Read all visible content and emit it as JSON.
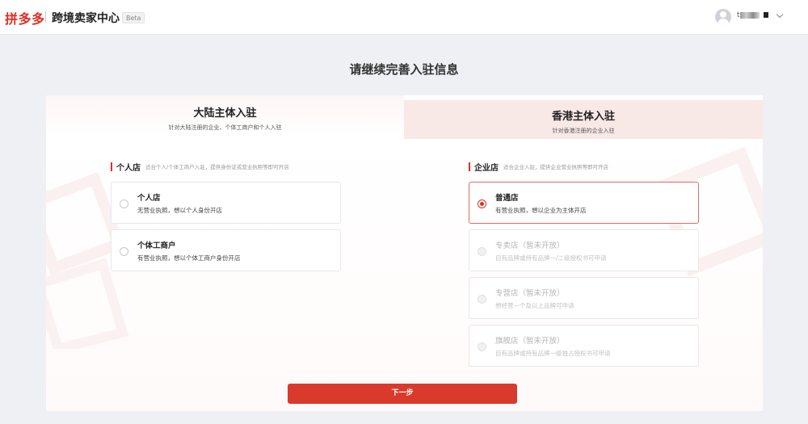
{
  "header": {
    "logo_text": "拼多多",
    "brand_title": "跨境卖家中心",
    "beta_label": "Beta",
    "user_name_prefix": "t"
  },
  "page": {
    "title": "请继续完善入驻信息"
  },
  "tabs": [
    {
      "title": "大陆主体入驻",
      "subtitle": "针对大陆注册的企业、个体工商户和个人入驻",
      "active": true
    },
    {
      "title": "香港主体入驻",
      "subtitle": "针对香港注册的企业入驻",
      "active": false
    }
  ],
  "personal_section": {
    "label": "个人店",
    "description": "适合个人/个体工商户入驻，提供身份证或营业执照等即可开店",
    "options": [
      {
        "title": "个人店",
        "desc": "无营业执照，想以个人身份开店"
      },
      {
        "title": "个体工商户",
        "desc": "有营业执照，想以个体工商户身份开店"
      }
    ]
  },
  "enterprise_section": {
    "label": "企业店",
    "description": "适合企业入驻，提供企业营业执照等即可开店",
    "options": [
      {
        "title": "普通店",
        "desc": "有营业执照，想以企业为主体开店",
        "selected": true
      },
      {
        "title": "专卖店（暂未开放）",
        "desc": "自有品牌或持有品牌一/二级授权书可申请",
        "disabled": true
      },
      {
        "title": "专营店（暂未开放）",
        "desc": "想经营一个及以上品牌可申请",
        "disabled": true
      },
      {
        "title": "旗舰店（暂未开放）",
        "desc": "自有品牌或持有品牌一级独占授权书可申请",
        "disabled": true
      }
    ]
  },
  "actions": {
    "next_label": "下一步"
  },
  "colors": {
    "brand_red": "#e02e24",
    "button_red": "#d93a2b",
    "tab_inactive_bg": "#f8e8e6",
    "page_bg": "#eff0f3"
  },
  "icons": [
    "avatar-icon",
    "chevron-down-icon",
    "radio-icon"
  ]
}
